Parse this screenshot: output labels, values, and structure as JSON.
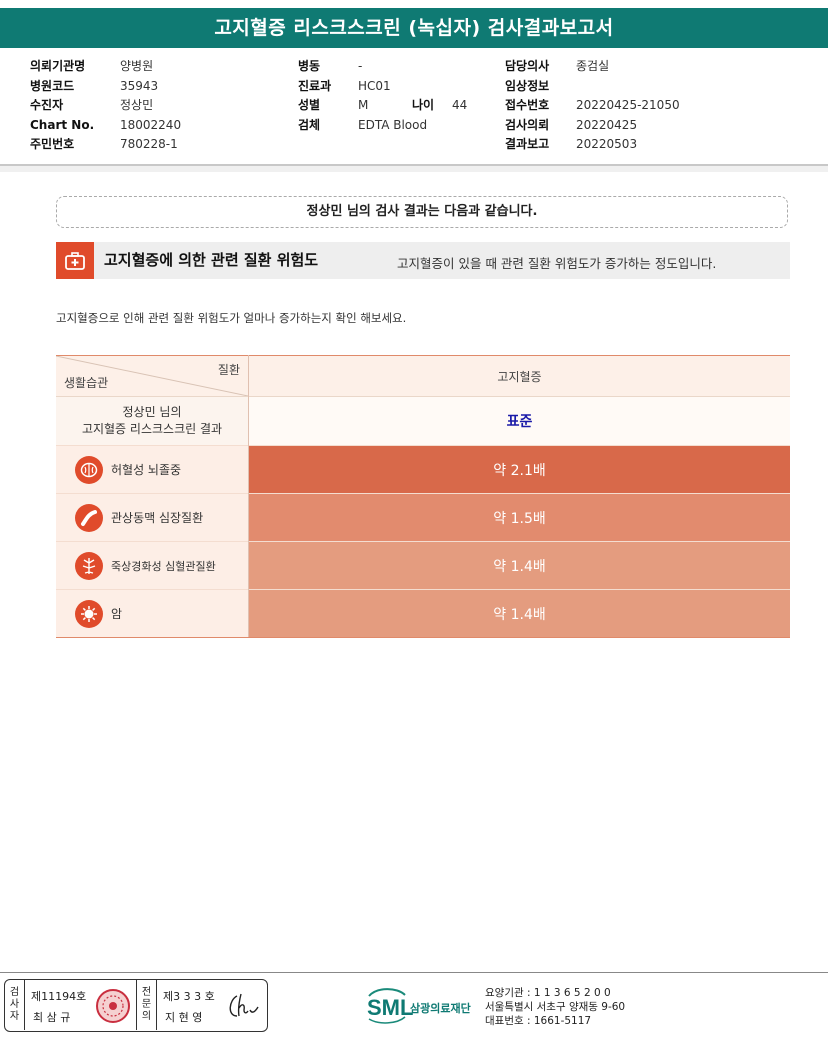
{
  "report": {
    "title": "고지혈증 리스크스크린 (녹십자) 검사결과보고서"
  },
  "meta": {
    "col1": [
      {
        "k": "의뢰기관명",
        "v": "양병원"
      },
      {
        "k": "병원코드",
        "v": "35943"
      },
      {
        "k": "수진자",
        "v": "정상민"
      },
      {
        "k": "Chart No.",
        "v": "18002240"
      },
      {
        "k": "주민번호",
        "v": "780228-1"
      }
    ],
    "col2": [
      {
        "k": "병동",
        "v": "-"
      },
      {
        "k": "진료과",
        "v": "HC01"
      },
      {
        "k": "성별",
        "v": "M"
      },
      {
        "k": "검체",
        "v": "EDTA Blood"
      }
    ],
    "age": {
      "k": "나이",
      "v": "44"
    },
    "col3": [
      {
        "k": "담당의사",
        "v": "종검실"
      },
      {
        "k": "임상정보",
        "v": ""
      },
      {
        "k": "접수번호",
        "v": "20220425-21050"
      },
      {
        "k": "검사의뢰",
        "v": "20220425"
      },
      {
        "k": "결과보고",
        "v": "20220503"
      }
    ]
  },
  "summary": {
    "text": "정상민 님의 검사 결과는 다음과 같습니다."
  },
  "section": {
    "title": "고지혈증에 의한 관련 질환 위험도",
    "desc": "고지혈증이 있을 때 관련 질환 위험도가 증가하는 정도입니다."
  },
  "intro": "고지혈증으로 인해 관련 질환 위험도가 얼마나 증가하는지 확인 해보세요.",
  "table": {
    "header_top": "질환",
    "header_bottom": "생활습관",
    "column": "고지혈증",
    "result_label_1": "정상민 님의",
    "result_label_2": "고지혈증 리스크스크린 결과",
    "result_value": "표준",
    "rows": [
      {
        "name": "허혈성 뇌졸중",
        "value": "약 2.1배",
        "icon": "brain-icon",
        "color": "#d8694a"
      },
      {
        "name": "관상동맥 심장질환",
        "value": "약 1.5배",
        "icon": "artery-icon",
        "color": "#e28b6e"
      },
      {
        "name": "죽상경화성 심혈관질환",
        "value": "약 1.4배",
        "icon": "vessel-icon",
        "color": "#e49c7f"
      },
      {
        "name": "암",
        "value": "약 1.4배",
        "icon": "cancer-cell-icon",
        "color": "#e49c7f"
      }
    ]
  },
  "footer": {
    "tester_label": [
      "검",
      "사",
      "자"
    ],
    "tester_no": "제11194호",
    "tester_name": "최 삼 규",
    "doctor_label": [
      "전",
      "문",
      "의"
    ],
    "doctor_no": "제3 3 3 호",
    "doctor_name": "지 현 영",
    "org_logo": "SML",
    "org_name": "삼광의료재단",
    "care_code": "요양기관 : 1 1 3 6 5 2 0 0",
    "address": "서울특별시 서초구 양재동 9-60",
    "phone": "대표번호 : 1661-5117"
  }
}
